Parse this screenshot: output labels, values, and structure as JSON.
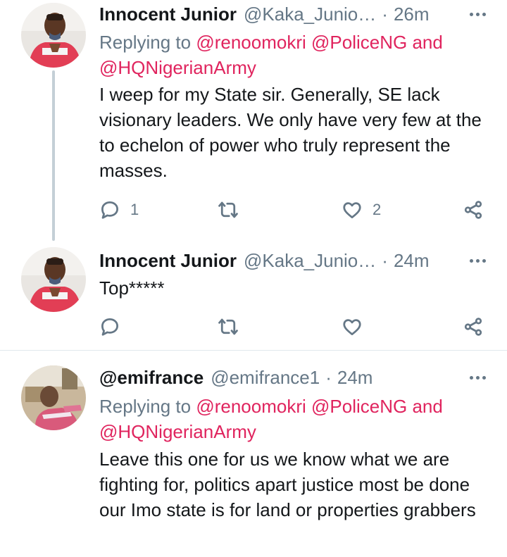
{
  "tweets": [
    {
      "name": "Innocent Junior",
      "handle": "@Kaka_Junio…",
      "separator": "·",
      "time": "26m",
      "replying_prefix": "Replying to",
      "mentions": [
        "@renoomokri",
        "@PoliceNG",
        "@HQNigerianArmy"
      ],
      "and_word": "and",
      "text": "I weep for my State sir. Generally, SE lack visionary leaders. We only have very few at the to echelon of power who truly represent the masses.",
      "reply_count": "1",
      "retweet_count": "",
      "like_count": "2"
    },
    {
      "name": "Innocent Junior",
      "handle": "@Kaka_Junio…",
      "separator": "·",
      "time": "24m",
      "text": "Top*****",
      "reply_count": "",
      "retweet_count": "",
      "like_count": ""
    },
    {
      "name": "@emifrance",
      "handle": "@emifrance1",
      "separator": "·",
      "time": "24m",
      "replying_prefix": "Replying to",
      "mentions": [
        "@renoomokri",
        "@PoliceNG",
        "@HQNigerianArmy"
      ],
      "and_word": "and",
      "text": "Leave this one for us we know what we are fighting for, politics apart justice most be done our Imo state is for land or properties grabbers"
    }
  ],
  "colors": {
    "mention": "#e0245e",
    "muted": "#657786",
    "thread_line": "#c4cfd6",
    "divider": "#e1e8ed"
  },
  "icons": [
    "reply-icon",
    "retweet-icon",
    "like-icon",
    "share-icon",
    "more-icon"
  ]
}
